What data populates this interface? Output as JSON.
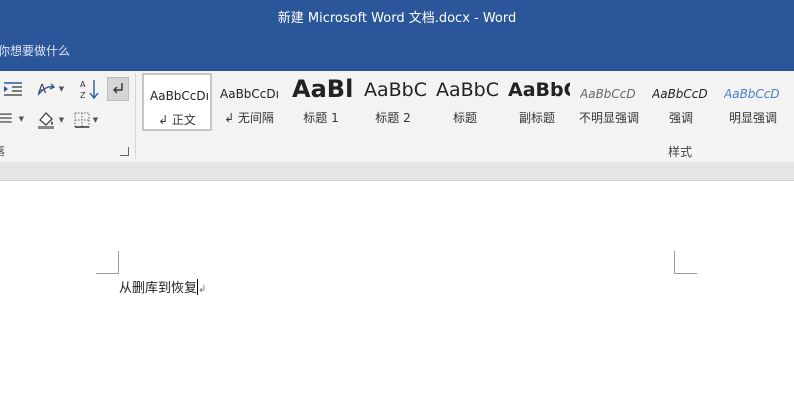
{
  "window": {
    "title": "新建 Microsoft Word 文档.docx  -  Word"
  },
  "tell_me": {
    "placeholder": "你想要做什么"
  },
  "ribbon": {
    "paragraph_group_label": "落",
    "styles_group_label": "样式",
    "styles": [
      {
        "sample": "AaBbCcDı",
        "label": "↲ 正文",
        "active": true
      },
      {
        "sample": "AaBbCcDı",
        "label": "↲ 无间隔",
        "active": false
      },
      {
        "sample": "AaBl",
        "label": "标题 1",
        "active": false
      },
      {
        "sample": "AaBbC",
        "label": "标题 2",
        "active": false
      },
      {
        "sample": "AaBbC",
        "label": "标题",
        "active": false
      },
      {
        "sample": "AaBbC",
        "label": "副标题",
        "active": false
      },
      {
        "sample": "AaBbCcD",
        "label": "不明显强调",
        "active": false
      },
      {
        "sample": "AaBbCcD",
        "label": "强调",
        "active": false
      },
      {
        "sample": "AaBbCcD",
        "label": "明显强调",
        "active": false
      }
    ],
    "icons": [
      "indent-icon",
      "text-direction-icon",
      "sort-icon",
      "paragraph-marks-icon",
      "shading-icon",
      "borders-icon",
      "align-icon"
    ]
  },
  "document": {
    "text": "从删库到恢复",
    "paragraph_mark": "↲"
  },
  "colors": {
    "title_bar": "#2b579a",
    "ribbon": "#f3f3f3",
    "page": "#ffffff"
  }
}
